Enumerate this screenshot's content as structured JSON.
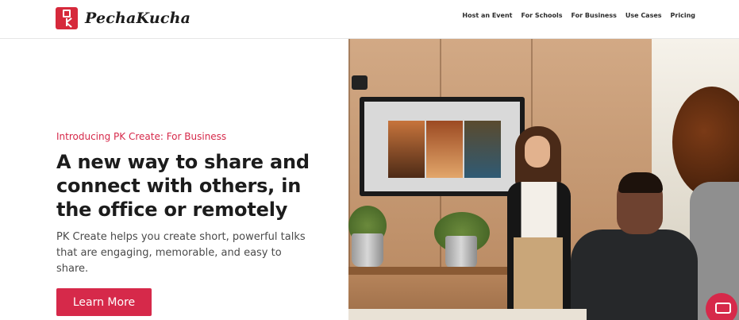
{
  "brand": {
    "name": "PechaKucha",
    "logo_icon": "pk-logo-icon",
    "accent": "#d6294a"
  },
  "nav": {
    "items": [
      {
        "label": "Host an Event"
      },
      {
        "label": "For Schools"
      },
      {
        "label": "For Business"
      },
      {
        "label": "Use Cases"
      },
      {
        "label": "Pricing"
      }
    ]
  },
  "hero": {
    "eyebrow": "Introducing PK Create: For Business",
    "headline": "A new way to share and connect with others, in the office or remotely",
    "subcopy": "PK Create helps you create short, powerful talks that are engaging, memorable, and easy to share.",
    "cta_label": "Learn More"
  },
  "widget": {
    "icon": "chat-icon"
  }
}
